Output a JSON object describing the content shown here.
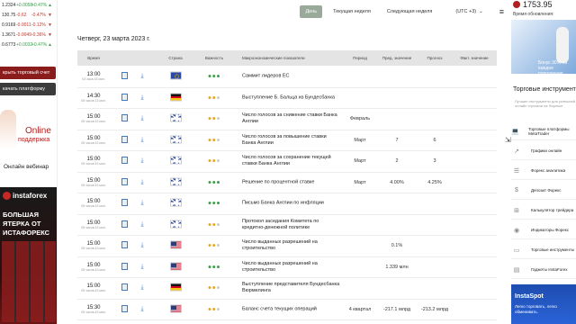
{
  "quotes": [
    {
      "price": "1.2324",
      "change": "+0.0058",
      "pct": "+0.47%",
      "dir": "up"
    },
    {
      "price": "130.75",
      "change": "-0.62",
      "pct": "-0.47%",
      "dir": "down"
    },
    {
      "price": "0.9169",
      "change": "-0.0011",
      "pct": "-0.12%",
      "dir": "down"
    },
    {
      "price": "1.3671",
      "change": "-0.0049",
      "pct": "-0.36%",
      "dir": "down"
    },
    {
      "price": "0.6773",
      "change": "+0.0032",
      "pct": "+0.47%",
      "dir": "up"
    }
  ],
  "left": {
    "open_account": "крыть торговый счет",
    "download_platform": "качать платформу",
    "support_online": "Online",
    "support_label": "поддержка",
    "webinar": "Онлайн вебинар",
    "ad_logo": "instaforex",
    "ad_line1": "БОЛЬШАЯ",
    "ad_line2": "ЯТЕРКА ОТ",
    "ad_line3": "ИСТАФОРЕКС"
  },
  "tabs": {
    "today": "День",
    "this_week": "Текущая неделя",
    "next_week": "Следующая неделя",
    "timezone": "(UTC +3)",
    "timezone_arrow": "⌄",
    "menu_icon": "≡"
  },
  "date_title": "Четверг, 23 марта 2023 г.",
  "headers": {
    "time": "Время",
    "country": "Страна",
    "importance": "Важность",
    "indicator": "Макроэкономические показатели",
    "period": "Период",
    "previous": "Пред. значение",
    "forecast": "Прогноз",
    "actual": "Факт. значение"
  },
  "rows": [
    {
      "time": "13:00",
      "ago": "03 часа 43 мин.",
      "flag": "eu",
      "imp": 3,
      "name": "Саммит лидеров ЕС",
      "period": "",
      "prev": "",
      "fc": "",
      "act": ""
    },
    {
      "time": "14:30",
      "ago": "05 часов 13 мин.",
      "flag": "de",
      "imp": 2,
      "name": "Выступление Б. Бальца из Бундесбанка",
      "period": "",
      "prev": "",
      "fc": "",
      "act": ""
    },
    {
      "time": "15:00",
      "ago": "05 часов 43 мин.",
      "flag": "gb",
      "imp": 2,
      "name": "Число голосов за снижение ставки Банка Англии",
      "period": "Февраль",
      "prev": "",
      "fc": "",
      "act": ""
    },
    {
      "time": "15:00",
      "ago": "05 часов 43 мин.",
      "flag": "gb",
      "imp": 2,
      "name": "Число голосов за повышение ставки Банка Англии",
      "period": "Март",
      "prev": "7",
      "fc": "6",
      "act": ""
    },
    {
      "time": "15:00",
      "ago": "05 часов 43 мин.",
      "flag": "gb",
      "imp": 2,
      "name": "Число голосов за сохранение текущей ставки Банка Англии",
      "period": "Март",
      "prev": "2",
      "fc": "3",
      "act": ""
    },
    {
      "time": "15:00",
      "ago": "05 часов 43 мин.",
      "flag": "gb",
      "imp": 3,
      "name": "Решение по процентной ставке",
      "period": "Март",
      "prev": "4.00%",
      "fc": "4.25%",
      "act": ""
    },
    {
      "time": "15:00",
      "ago": "05 часов 43 мин.",
      "flag": "gb",
      "imp": 3,
      "name": "Письмо Банка Англии по инфляции",
      "period": "",
      "prev": "",
      "fc": "",
      "act": ""
    },
    {
      "time": "15:00",
      "ago": "05 часов 43 мин.",
      "flag": "gb",
      "imp": 2,
      "name": "Протокол заседания Комитета по кредитно-денежной политике",
      "period": "",
      "prev": "",
      "fc": "",
      "act": ""
    },
    {
      "time": "15:00",
      "ago": "05 часов 43 мин.",
      "flag": "us",
      "imp": 2,
      "name": "Число выданных разрешений на строительство",
      "period": "",
      "prev": "0.1%",
      "fc": "",
      "act": ""
    },
    {
      "time": "15:00",
      "ago": "05 часов 43 мин.",
      "flag": "us",
      "imp": 3,
      "name": "Число выданных разрешений на строительство",
      "period": "",
      "prev": "1.339 млн",
      "fc": "",
      "act": ""
    },
    {
      "time": "15:00",
      "ago": "05 часов 43 мин.",
      "flag": "de",
      "imp": 2,
      "name": "Выступление представителя Бундесбанка Вюрмелинга",
      "period": "",
      "prev": "",
      "fc": "",
      "act": ""
    },
    {
      "time": "15:30",
      "ago": "05 часов 43 мин.",
      "flag": "us",
      "imp": 2,
      "name": "Баланс счета текущих операций",
      "period": "4 квартал",
      "prev": "-217.1 млрд",
      "fc": "-213.2 млрд",
      "act": ""
    }
  ],
  "right": {
    "price": "1753.95",
    "updated": "Время обновления:",
    "ad_text": "Бонус 30% на каждое пополнение",
    "tools_title": "Торговые инструмент",
    "tools_sub": "Лучшие инструменты для успешной онлайн торговли на Форексе",
    "items": [
      {
        "icon": "💻",
        "label": "Торговые платформы MetaTrader"
      },
      {
        "icon": "↗",
        "label": "Графики онлайн"
      },
      {
        "icon": "☰",
        "label": "Форекс аналитика"
      },
      {
        "icon": "$",
        "label": "Депозит Форекс"
      },
      {
        "icon": "⊞",
        "label": "Калькулятор трейдера"
      },
      {
        "icon": "◉",
        "label": "Индикаторы Форекс"
      },
      {
        "icon": "▭",
        "label": "Торговые инструменты"
      },
      {
        "icon": "▤",
        "label": "Гаджеты InstaForex"
      }
    ],
    "spot_title": "InstaSpot",
    "spot_sub": "Легко торговать, легко обменивать."
  },
  "colors": {
    "accent_tab": "#9aaa9a",
    "high": "#3aa04a",
    "medium": "#e5a823",
    "brand": "#8b1c1c"
  }
}
